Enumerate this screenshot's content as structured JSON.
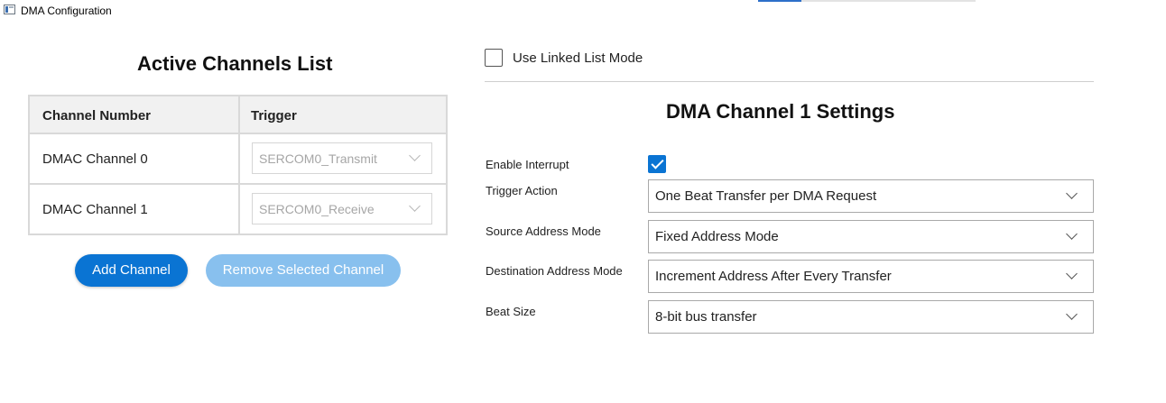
{
  "window": {
    "title": "DMA Configuration"
  },
  "left_panel": {
    "heading": "Active Channels List",
    "table": {
      "columns": [
        "Channel Number",
        "Trigger"
      ],
      "rows": [
        {
          "channel": "DMAC Channel 0",
          "trigger": "SERCOM0_Transmit"
        },
        {
          "channel": "DMAC Channel 1",
          "trigger": "SERCOM0_Receive"
        }
      ]
    },
    "add_button": "Add Channel",
    "remove_button": "Remove Selected Channel"
  },
  "right_panel": {
    "linked_list": {
      "label": "Use Linked List Mode",
      "checked": false
    },
    "heading": "DMA Channel 1 Settings",
    "enable_interrupt": {
      "label": "Enable Interrupt",
      "checked": true
    },
    "trigger_action": {
      "label": "Trigger Action",
      "value": "One Beat Transfer per DMA Request"
    },
    "source_address_mode": {
      "label": "Source Address Mode",
      "value": "Fixed Address Mode"
    },
    "destination_address_mode": {
      "label": "Destination Address Mode",
      "value": "Increment Address After Every Transfer"
    },
    "beat_size": {
      "label": "Beat Size",
      "value": "8-bit bus transfer"
    }
  },
  "colors": {
    "accent": "#0a74d3",
    "accent_disabled": "#88c0ee",
    "table_border": "#d9d9d9",
    "header_bg": "#f1f1f1"
  },
  "icons": [
    "app-window-icon",
    "chevron-down-icon",
    "checkmark-icon"
  ]
}
